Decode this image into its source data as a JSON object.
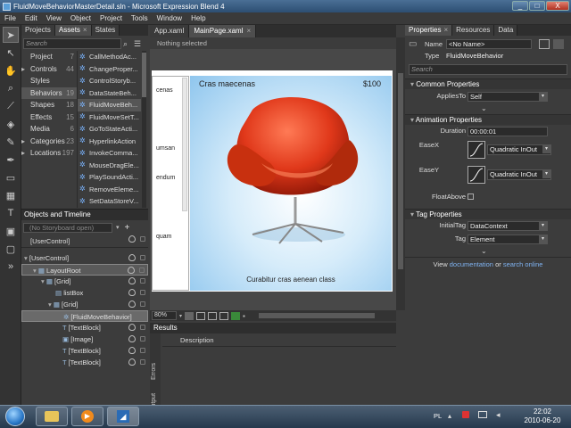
{
  "window": {
    "title": "FluidMoveBehaviorMasterDetail.sln - Microsoft Expression Blend 4",
    "controls": [
      "_",
      "□",
      "X"
    ]
  },
  "menu": [
    "File",
    "Edit",
    "View",
    "Object",
    "Project",
    "Tools",
    "Window",
    "Help"
  ],
  "left_tabs": [
    {
      "label": "Projects"
    },
    {
      "label": "Assets"
    },
    {
      "label": "States"
    }
  ],
  "assets": {
    "search_placeholder": "Search",
    "categories": [
      {
        "label": "Project",
        "count": "7"
      },
      {
        "label": "Controls",
        "count": "44"
      },
      {
        "label": "Styles",
        "count": ""
      },
      {
        "label": "Behaviors",
        "count": "19"
      },
      {
        "label": "Shapes",
        "count": "18"
      },
      {
        "label": "Effects",
        "count": "15"
      },
      {
        "label": "Media",
        "count": "6"
      },
      {
        "label": "Categories",
        "count": "23"
      },
      {
        "label": "Locations",
        "count": "197"
      }
    ],
    "items": [
      "CallMethodAc...",
      "ChangeProper...",
      "ControlStoryb...",
      "DataStateBeh...",
      "FluidMoveBeh...",
      "FluidMoveSetT...",
      "GoToStateActi...",
      "HyperlinkAction",
      "InvokeComma...",
      "MouseDragEle...",
      "PlaySoundActi...",
      "RemoveEleme...",
      "SetDataStoreV..."
    ]
  },
  "objects": {
    "title": "Objects and Timeline",
    "storyboard": "(No Storyboard open)",
    "scope": "[UserControl]",
    "tree": [
      "[UserControl]",
      "LayoutRoot",
      "[Grid]",
      "listBox",
      "[Grid]",
      "[FluidMoveBehavior]",
      "[TextBlock]",
      "[Image]",
      "[TextBlock]",
      "[TextBlock]"
    ]
  },
  "doc": {
    "tabs": [
      {
        "label": "App.xaml"
      },
      {
        "label": "MainPage.xaml"
      }
    ],
    "breadcrumb": "Nothing selected",
    "list_items": [
      "cenas",
      "umsan",
      "endum",
      "quam"
    ],
    "detail_title": "Cras maecenas",
    "price": "$100",
    "caption": "Curabitur cras aenean class",
    "zoom": "80%"
  },
  "results": {
    "title": "Results",
    "column": "Description",
    "side_tabs": [
      "Errors",
      "Output"
    ]
  },
  "properties": {
    "tabs": [
      {
        "label": "Properties"
      },
      {
        "label": "Resources"
      },
      {
        "label": "Data"
      }
    ],
    "name_label": "Name",
    "name_value": "<No Name>",
    "type_label": "Type",
    "type_value": "FluidMoveBehavior",
    "search_placeholder": "Search",
    "sections": {
      "common": "Common Properties",
      "anim": "Animation Properties",
      "tag": "Tag Properties"
    },
    "applies_to_label": "AppliesTo",
    "applies_to_value": "Self",
    "duration_label": "Duration",
    "duration_value": "00:00:01",
    "easex_label": "EaseX",
    "easex_value": "Quadratic InOut",
    "easey_label": "EaseY",
    "easey_value": "Quadratic InOut",
    "floatabove_label": "FloatAbove",
    "initialtag_label": "InitialTag",
    "initialtag_value": "DataContext",
    "tag_label": "Tag",
    "tag_value": "Element",
    "footer_pre": "View",
    "footer_link1": "documentation",
    "footer_mid": "or",
    "footer_link2": "search online"
  },
  "taskbar": {
    "lang": "PL",
    "time": "22:02",
    "date": "2010-06-20"
  },
  "colors": {
    "accent": "#4a90d9",
    "chair": "#e0381a",
    "link": "#7fb2f0"
  }
}
